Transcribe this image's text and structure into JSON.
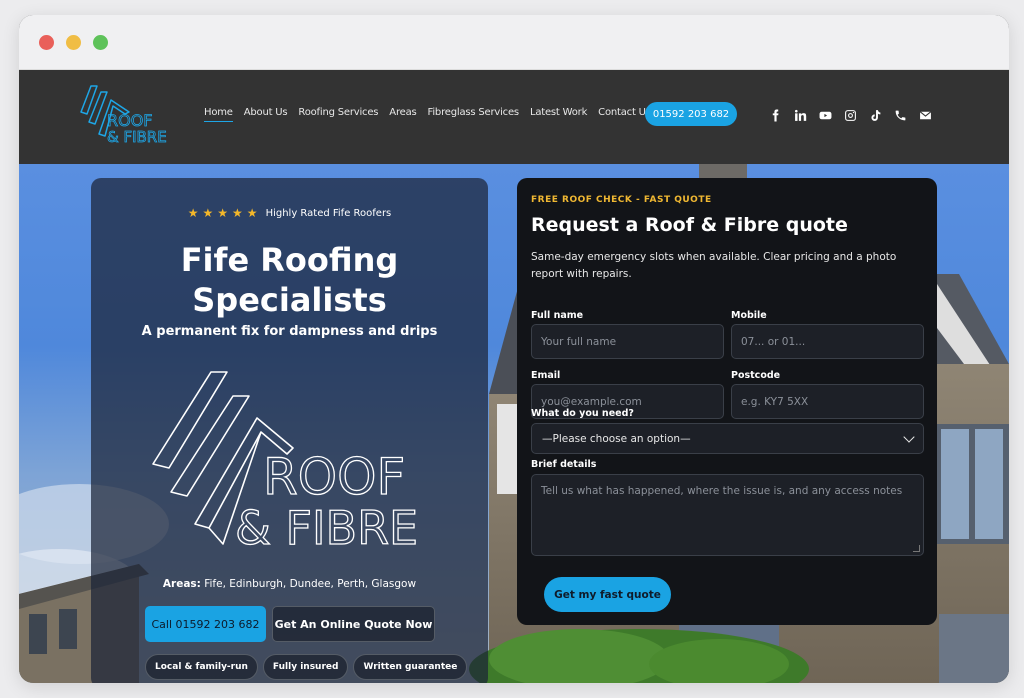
{
  "nav": {
    "links": [
      "Home",
      "About Us",
      "Roofing Services",
      "Areas",
      "Fibreglass Services",
      "Latest Work",
      "Contact Us"
    ],
    "phone": "01592 203 682",
    "socials": [
      "facebook-icon",
      "linkedin-icon",
      "youtube-icon",
      "instagram-icon",
      "tiktok-icon",
      "phone-icon",
      "email-icon"
    ]
  },
  "logo": {
    "line1": "ROOF",
    "line2": "& FIBRE"
  },
  "hero": {
    "rating_text": "Highly Rated Fife Roofers",
    "star_count": 5,
    "title": "Fife Roofing Specialists",
    "subtitle": "A permanent fix for dampness and drips",
    "areas_label": "Areas:",
    "areas_list": "Fife, Edinburgh, Dundee, Perth, Glasgow",
    "call_button": "Call 01592 203 682",
    "quote_button": "Get An Online Quote Now",
    "badges": [
      "Local & family-run",
      "Fully insured",
      "Written guarantee"
    ]
  },
  "form": {
    "eyebrow": "FREE ROOF CHECK - FAST QUOTE",
    "title": "Request a Roof & Fibre quote",
    "description": "Same-day emergency slots when available. Clear pricing and a photo report with repairs.",
    "full_name": {
      "label": "Full name",
      "placeholder": "Your full name"
    },
    "mobile": {
      "label": "Mobile",
      "placeholder": "07... or 01..."
    },
    "email": {
      "label": "Email",
      "placeholder": "you@example.com"
    },
    "postcode": {
      "label": "Postcode",
      "placeholder": "e.g. KY7 5XX"
    },
    "need": {
      "label": "What do you need?",
      "selected": "—Please choose an option—"
    },
    "details": {
      "label": "Brief details",
      "placeholder": "Tell us what has happened, where the issue is, and any access notes"
    },
    "submit": "Get my fast quote"
  },
  "colors": {
    "accent": "#1aa3e3",
    "star": "#f3b72a",
    "eyebrow": "#f0b832",
    "nav_bg": "#333333"
  }
}
